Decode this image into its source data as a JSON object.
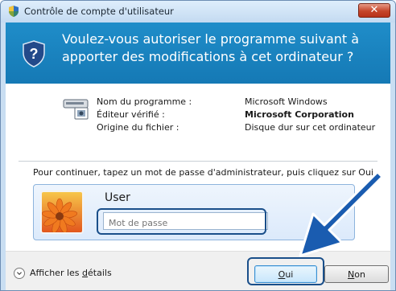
{
  "window": {
    "title": "Contrôle de compte d'utilisateur",
    "close_glyph": "✕"
  },
  "header": {
    "question": "Voulez-vous autoriser le programme suivant à apporter des modifications à cet ordinateur ?"
  },
  "program_info": {
    "labels": [
      "Nom du programme :",
      "Éditeur vérifié :",
      "Origine du fichier :"
    ],
    "values": [
      "Microsoft Windows",
      "Microsoft Corporation",
      "Disque dur sur cet ordinateur"
    ]
  },
  "instructions": "Pour continuer, tapez un mot de passe d'administrateur, puis cliquez sur Oui.",
  "credential": {
    "user_name": "User",
    "password_placeholder": "Mot de passe"
  },
  "footer": {
    "details_label_prefix": "Afficher les ",
    "details_label_accel": "d",
    "details_label_suffix": "étails",
    "yes_accel": "O",
    "yes_rest": "ui",
    "no_accel": "N",
    "no_rest": "on"
  },
  "icons": {
    "title": "uac-shield-icon",
    "header": "uac-shield-question-icon",
    "program": "scanner-program-icon",
    "avatar": "flower-avatar-icon",
    "details": "chevron-down-circle-icon",
    "callout": "callout-arrow-icon"
  },
  "colors": {
    "header_blue": "#1f8dc9",
    "highlight": "#1a4f8a",
    "arrow": "#1a5cb0"
  }
}
